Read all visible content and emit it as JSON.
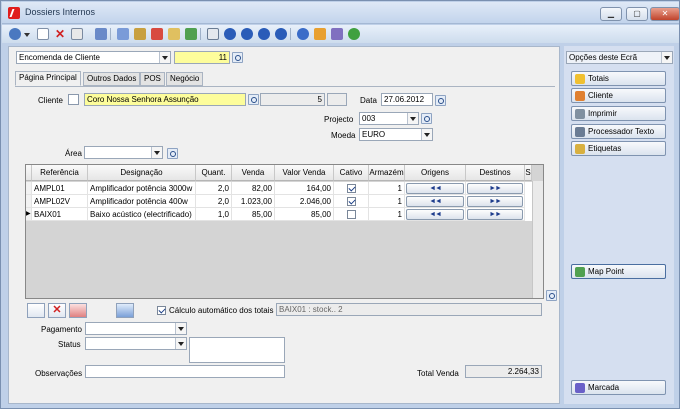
{
  "window": {
    "title": "Dossiers Internos",
    "min": "▁",
    "max": "▢",
    "close": "✕"
  },
  "header": {
    "doc_type": "Encomenda de Cliente",
    "doc_number": "11"
  },
  "side_panel": {
    "title": "Opções deste Ecrã",
    "buttons": [
      "Totais",
      "Cliente",
      "Imprimir",
      "Processador Texto",
      "Etiquetas",
      "Map Point",
      "Marcada"
    ],
    "colors": {
      "Totais": "#f0c030",
      "Cliente": "#e08030",
      "Imprimir": "#8090a0",
      "Processador Texto": "#6a7c94",
      "Etiquetas": "#d8b040",
      "Map Point": "#50a050",
      "Marcada": "#6a60c8"
    }
  },
  "tabs": [
    "Página Principal",
    "Outros Dados",
    "POS",
    "Negócio"
  ],
  "form": {
    "cliente_label": "Cliente",
    "cliente_name": "Coro Nossa Senhora Assunção",
    "cliente_num": "5",
    "data_label": "Data",
    "data_value": "27.06.2012",
    "projecto_label": "Projecto",
    "projecto_value": "003",
    "moeda_label": "Moeda",
    "moeda_value": "EURO",
    "area_label": "Área",
    "area_value": ""
  },
  "grid": {
    "columns": [
      "Referência",
      "Designação",
      "Quant.",
      "Venda",
      "Valor Venda",
      "Cativo",
      "Armazém",
      "Origens",
      "Destinos",
      "S"
    ],
    "rows": [
      {
        "ref": "AMPL01",
        "design": "Amplificador potência 3000w",
        "qty": "2,0",
        "venda": "82,00",
        "valor": "164,00",
        "cativo": true,
        "armazem": "1",
        "orig": "◄◄",
        "dest": "►►"
      },
      {
        "ref": "AMPL02V",
        "design": "Amplificador potência 400w",
        "qty": "2,0",
        "venda": "1.023,00",
        "valor": "2.046,00",
        "cativo": true,
        "armazem": "1",
        "orig": "◄◄",
        "dest": "►►"
      },
      {
        "ref": "BAIX01",
        "design": "Baixo acústico (electrificado)",
        "qty": "1,0",
        "venda": "85,00",
        "valor": "85,00",
        "cativo": false,
        "armazem": "1",
        "orig": "◄◄",
        "dest": "►►"
      }
    ]
  },
  "bottom": {
    "calc_auto_label": "Cálculo automático dos totais",
    "stock_info": "BAIX01 : stock.. 2",
    "pagamento_label": "Pagamento",
    "status_label": "Status",
    "observacoes_label": "Observações",
    "total_label": "Total Venda",
    "total_value": "2.264,33"
  }
}
